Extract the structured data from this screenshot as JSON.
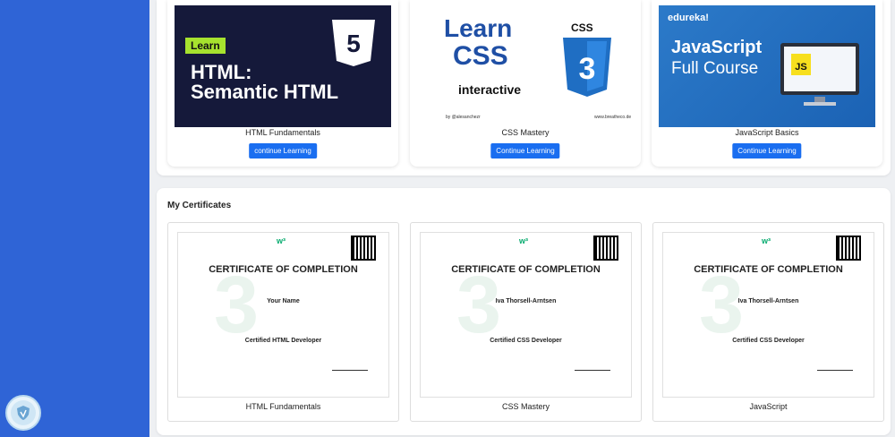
{
  "courses": [
    {
      "title": "HTML Fundamentals",
      "button": "continue Learning",
      "thumb": {
        "tag": "Learn",
        "line1": "HTML:",
        "line2": "Semantic HTML"
      }
    },
    {
      "title": "CSS Mastery",
      "button": "Continue Learning",
      "thumb": {
        "line1": "Learn",
        "line2": "CSS",
        "interactive": "interactive",
        "badge": "CSS",
        "by": "by @alesanchezr",
        "site": "www.breatheco.de"
      }
    },
    {
      "title": "JavaScript Basics",
      "button": "Continue Learning",
      "thumb": {
        "brand": "edureka!",
        "line1": "JavaScript",
        "line2": "Full Course"
      }
    }
  ],
  "certificates": {
    "heading": "My Certificates",
    "items": [
      {
        "title": "HTML Fundamentals",
        "header": "CERTIFICATE OF COMPLETION",
        "name": "Your Name",
        "course": "Certified HTML Developer"
      },
      {
        "title": "CSS Mastery",
        "header": "CERTIFICATE OF COMPLETION",
        "name": "Iva Thorsell-Arntsen",
        "course": "Certified CSS Developer"
      },
      {
        "title": "JavaScript",
        "header": "CERTIFICATE OF COMPLETION",
        "name": "Iva Thorsell-Arntsen",
        "course": "Certified CSS Developer"
      }
    ]
  },
  "colors": {
    "sidebar": "#2f64d6",
    "button": "#1a6ef0",
    "brand_green": "#04aa6d"
  }
}
